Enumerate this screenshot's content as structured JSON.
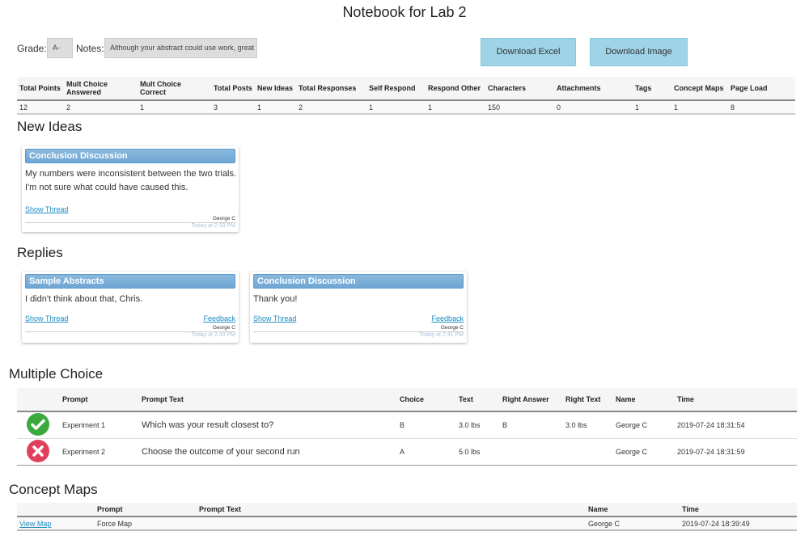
{
  "title": "Notebook for Lab 2",
  "grade_label": "Grade:",
  "grade_value": "A-",
  "notes_label": "Notes:",
  "notes_value": "Although your abstract could use work, great",
  "buttons": {
    "excel": "Download Excel",
    "image": "Download Image"
  },
  "stats": {
    "headers": [
      "Total Points",
      "Mult Choice Answered",
      "Mult Choice Correct",
      "Total Posts",
      "New Ideas",
      "Total Responses",
      "Self Respond",
      "Respond Other",
      "Characters",
      "Attachments",
      "Tags",
      "Concept Maps",
      "Page Load"
    ],
    "values": [
      "12",
      "2",
      "1",
      "3",
      "1",
      "2",
      "1",
      "1",
      "150",
      "0",
      "1",
      "1",
      "8"
    ]
  },
  "new_ideas": {
    "heading": "New Ideas",
    "cards": [
      {
        "title": "Conclusion Discussion",
        "lines": [
          "My numbers were inconsistent between the two trials.",
          "I'm not sure what could have caused this."
        ],
        "show_thread": "Show Thread",
        "author": "George C",
        "time": "Today at 2:33 PM"
      }
    ]
  },
  "replies": {
    "heading": "Replies",
    "cards": [
      {
        "title": "Sample Abstracts",
        "text": "I didn't think about that, Chris.",
        "show_thread": "Show Thread",
        "feedback": "Feedback",
        "author": "George C",
        "time": "Today at 2:40 PM"
      },
      {
        "title": "Conclusion Discussion",
        "text": "Thank you!",
        "show_thread": "Show Thread",
        "feedback": "Feedback",
        "author": "George C",
        "time": "Today at 2:41 PM"
      }
    ]
  },
  "multiple_choice": {
    "heading": "Multiple Choice",
    "headers": [
      "",
      "Prompt",
      "Prompt Text",
      "Choice",
      "Text",
      "Right Answer",
      "Right Text",
      "Name",
      "Time"
    ],
    "rows": [
      {
        "status": "correct",
        "prompt": "Experiment 1",
        "prompt_text": "Which was your result closest to?",
        "choice": "B",
        "text": "3.0 lbs",
        "right_answer": "B",
        "right_text": "3.0 lbs",
        "name": "George C",
        "time": "2019-07-24 18:31:54"
      },
      {
        "status": "incorrect",
        "prompt": "Experiment 2",
        "prompt_text": "Choose the outcome of your second run",
        "choice": "A",
        "text": "5.0 lbs",
        "right_answer": "",
        "right_text": "",
        "name": "George C",
        "time": "2019-07-24 18:31:59"
      }
    ]
  },
  "concept_maps": {
    "heading": "Concept Maps",
    "headers": [
      "",
      "Prompt",
      "Prompt Text",
      "Name",
      "Time"
    ],
    "rows": [
      {
        "link": "View Map",
        "prompt": "Force Map",
        "prompt_text": "",
        "name": "George C",
        "time": "2019-07-24 18:39:49"
      }
    ]
  },
  "colors": {
    "accent": "#9fd3e8",
    "correct": "#3aaa3f",
    "incorrect": "#e0405e"
  }
}
